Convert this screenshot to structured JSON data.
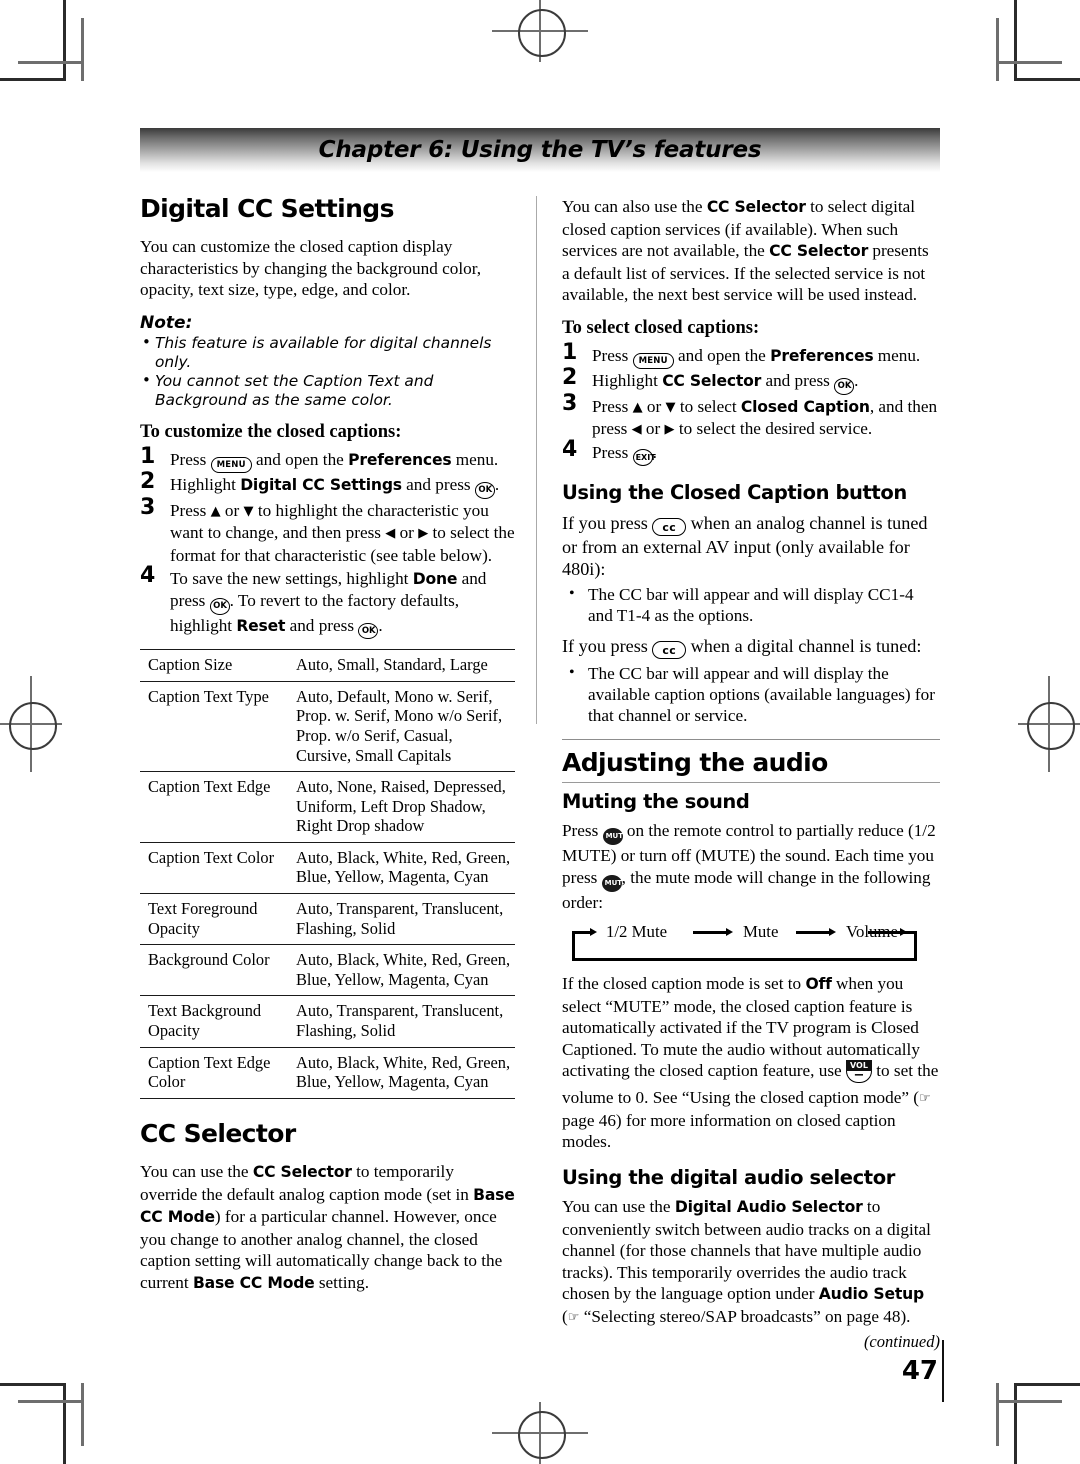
{
  "banner": {
    "title": "Chapter 6: Using the TV’s features"
  },
  "page_number": "47",
  "left": {
    "heading": "Digital CC Settings",
    "intro": "You can customize the closed caption display characteristics by changing the background color, opacity, text size, type, edge, and color.",
    "note_label": "Note:",
    "notes": [
      "This feature is available for digital channels only.",
      "You cannot set the Caption Text and Background as the same color."
    ],
    "howto_heading": "To customize the closed captions:",
    "steps": [
      {
        "num": "1",
        "parts": [
          "Press ",
          "MENU",
          " and open the ",
          "Preferences",
          " menu."
        ]
      },
      {
        "num": "2",
        "parts": [
          "Highlight ",
          "Digital CC Settings",
          " and press ",
          "OK",
          "."
        ]
      },
      {
        "num": "3",
        "parts": [
          "Press ▲ or ▼ to highlight the characteristic you want to change, and then press ◀ or ▶ to select the format for that characteristic (see table below)."
        ]
      },
      {
        "num": "4",
        "parts": [
          "To save the new settings, highlight ",
          "Done",
          " and press ",
          "OK",
          ". To revert to the factory defaults, highlight ",
          "Reset",
          " and press ",
          "OK",
          "."
        ]
      }
    ],
    "table": {
      "rows": [
        {
          "characteristic": "Caption Size",
          "options": "Auto, Small, Standard, Large"
        },
        {
          "characteristic": "Caption Text Type",
          "options": "Auto, Default, Mono w. Serif, Prop. w. Serif, Mono w/o Serif, Prop. w/o Serif, Casual, Cursive, Small Capitals"
        },
        {
          "characteristic": "Caption Text Edge",
          "options": "Auto, None, Raised, Depressed, Uniform, Left Drop Shadow, Right Drop shadow"
        },
        {
          "characteristic": "Caption Text Color",
          "options": "Auto, Black, White, Red, Green, Blue, Yellow, Magenta, Cyan"
        },
        {
          "characteristic": "Text Foreground Opacity",
          "options": "Auto, Transparent, Translucent, Flashing, Solid"
        },
        {
          "characteristic": "Background Color",
          "options": "Auto, Black, White, Red, Green, Blue, Yellow, Magenta, Cyan"
        },
        {
          "characteristic": "Text Background Opacity",
          "options": "Auto, Transparent, Translucent, Flashing, Solid"
        },
        {
          "characteristic": "Caption Text Edge Color",
          "options": "Auto, Black, White, Red, Green, Blue, Yellow, Magenta, Cyan"
        }
      ]
    },
    "cc_selector_heading": "CC Selector",
    "cc_selector_body": {
      "t1": "You can use the ",
      "b1": "CC Selector",
      "t2": " to temporarily override the default analog caption mode (set in ",
      "b2": "Base CC Mode",
      "t3": ") for a particular channel. However, once you change to another analog channel, the closed caption setting will automatically change back to the current ",
      "b3": "Base CC Mode",
      "t4": " setting."
    }
  },
  "right": {
    "intro": {
      "t1": "You can also use the ",
      "b1": "CC Selector",
      "t2": " to select digital closed caption services (if available). When such services are not available, the ",
      "b2": "CC Selector",
      "t3": " presents a default list of services. If the selected service is not available, the next best service will be used instead."
    },
    "select_heading": "To select closed captions:",
    "select_steps": [
      {
        "num": "1",
        "label": "Press MENU and open the Preferences menu."
      },
      {
        "num": "2",
        "label": "Highlight CC Selector and press OK."
      },
      {
        "num": "3",
        "label": "Press ▲ or ▼ to select Closed Caption, and then press ◀ or ▶ to select the desired service."
      },
      {
        "num": "4",
        "label": "Press EXIT."
      }
    ],
    "cc_button_heading": "Using the Closed Caption button",
    "analog_lead_1": "If you press ",
    "analog_lead_2": " when an analog channel is tuned or from an external AV input (only available for 480i):",
    "analog_bullet": "The CC bar will appear and will display CC1-4 and T1-4 as the options.",
    "digital_lead_1": "If you press ",
    "digital_lead_2": " when a digital channel is tuned:",
    "digital_bullet": "The CC bar will appear and will display the available caption options (available languages) for that channel or service.",
    "audio_heading": "Adjusting the audio",
    "mute_heading": "Muting the sound",
    "mute_body": {
      "t1": "Press ",
      "t2": " on the remote control to partially reduce (1/2 MUTE) or turn off (MUTE) the sound. Each time you press ",
      "t3": ", the mute mode will change in the following order:"
    },
    "mute_cycle": [
      "1/2 Mute",
      "Mute",
      "Volume"
    ],
    "mute_note": {
      "t1": "If the closed caption mode is set to ",
      "b1": "Off",
      "t2": " when you select “MUTE” mode, the closed caption feature is automatically activated if the TV program is Closed Captioned. To mute the audio without automatically activating the closed caption feature, use ",
      "t3": " to set the volume to 0. See “Using the closed caption mode” (",
      "t4": " page 46) for more information on closed caption modes."
    },
    "digital_audio_heading": "Using the digital audio selector",
    "digital_audio_body": {
      "t1": "You can use the ",
      "b1": "Digital Audio Selector",
      "t2": " to conveniently switch between audio tracks on a digital channel (for those channels that have multiple audio tracks). This temporarily overrides the audio track chosen by the language option under ",
      "b2": "Audio Setup",
      "t3": " (",
      "t4": " “Selecting stereo/SAP broadcasts” on page 48)."
    },
    "continued": "(continued)"
  },
  "keys": {
    "menu": "MENU",
    "ok": "OK",
    "exit": "EXIT",
    "cc": "cc",
    "mute": "MUTE",
    "vol_label": "VOL",
    "vol_minus": "−"
  }
}
